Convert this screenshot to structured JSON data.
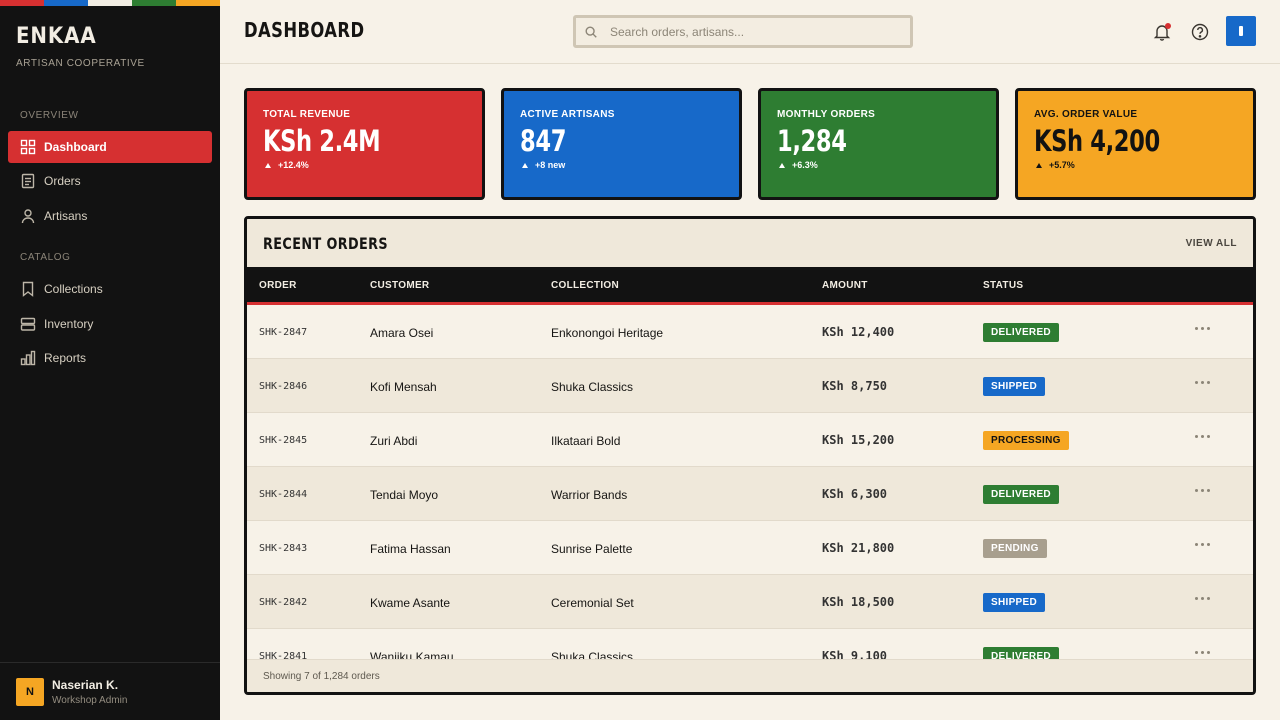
{
  "brand": {
    "name": "ENKAA",
    "subtitle": "ARTISAN COOPERATIVE",
    "stripe_colors": [
      "#d63031",
      "#1769c9",
      "#f2ede3",
      "#2e7d32",
      "#f5a623"
    ]
  },
  "sidebar": {
    "sections": [
      {
        "label": "OVERVIEW"
      },
      {
        "label": "CATALOG"
      }
    ],
    "items": [
      {
        "label": "Dashboard",
        "icon": "grid-icon",
        "active": true
      },
      {
        "label": "Orders",
        "icon": "document-icon"
      },
      {
        "label": "Artisans",
        "icon": "person-icon"
      },
      {
        "label": "Collections",
        "icon": "bookmark-icon"
      },
      {
        "label": "Inventory",
        "icon": "layers-icon"
      },
      {
        "label": "Reports",
        "icon": "bar-chart-icon"
      }
    ],
    "user": {
      "initial": "N",
      "name": "Naserian K.",
      "role": "Workshop Admin"
    }
  },
  "header": {
    "title": "DASHBOARD",
    "search_placeholder": "Search orders, artisans...",
    "icons": [
      "bell-icon",
      "help-icon",
      "profile-icon"
    ]
  },
  "stats": [
    {
      "label": "TOTAL REVENUE",
      "value": "KSh 2.4M",
      "change": "+12.4%",
      "bg": "#d63031",
      "fg": "#ffffff"
    },
    {
      "label": "ACTIVE ARTISANS",
      "value": "847",
      "change": "+8 new",
      "bg": "#1769c9",
      "fg": "#ffffff"
    },
    {
      "label": "MONTHLY ORDERS",
      "value": "1,284",
      "change": "+6.3%",
      "bg": "#2e7d32",
      "fg": "#ffffff"
    },
    {
      "label": "AVG. ORDER VALUE",
      "value": "KSh 4,200",
      "change": "+5.7%",
      "bg": "#f5a623",
      "fg": "#121212"
    }
  ],
  "orders": {
    "title": "RECENT ORDERS",
    "view_all": "VIEW ALL",
    "columns": [
      "ORDER",
      "CUSTOMER",
      "COLLECTION",
      "AMOUNT",
      "STATUS"
    ],
    "rows": [
      {
        "id": "SHK-2847",
        "customer": "Amara Osei",
        "collection": "Enkonongoi Heritage",
        "amount": "KSh 12,400",
        "status": "DELIVERED"
      },
      {
        "id": "SHK-2846",
        "customer": "Kofi Mensah",
        "collection": "Shuka Classics",
        "amount": "KSh 8,750",
        "status": "SHIPPED"
      },
      {
        "id": "SHK-2845",
        "customer": "Zuri Abdi",
        "collection": "Ilkataari Bold",
        "amount": "KSh 15,200",
        "status": "PROCESSING"
      },
      {
        "id": "SHK-2844",
        "customer": "Tendai Moyo",
        "collection": "Warrior Bands",
        "amount": "KSh 6,300",
        "status": "DELIVERED"
      },
      {
        "id": "SHK-2843",
        "customer": "Fatima Hassan",
        "collection": "Sunrise Palette",
        "amount": "KSh 21,800",
        "status": "PENDING"
      },
      {
        "id": "SHK-2842",
        "customer": "Kwame Asante",
        "collection": "Ceremonial Set",
        "amount": "KSh 18,500",
        "status": "SHIPPED"
      },
      {
        "id": "SHK-2841",
        "customer": "Wanjiku Kamau",
        "collection": "Shuka Classics",
        "amount": "KSh 9,100",
        "status": "DELIVERED"
      }
    ],
    "status_colors": {
      "DELIVERED": {
        "bg": "#2e7d32",
        "fg": "#ffffff"
      },
      "SHIPPED": {
        "bg": "#1769c9",
        "fg": "#ffffff"
      },
      "PROCESSING": {
        "bg": "#f5a623",
        "fg": "#121212"
      },
      "PENDING": {
        "bg": "#a89f8e",
        "fg": "#ffffff"
      }
    },
    "footer": "Showing 7 of 1,284 orders"
  }
}
